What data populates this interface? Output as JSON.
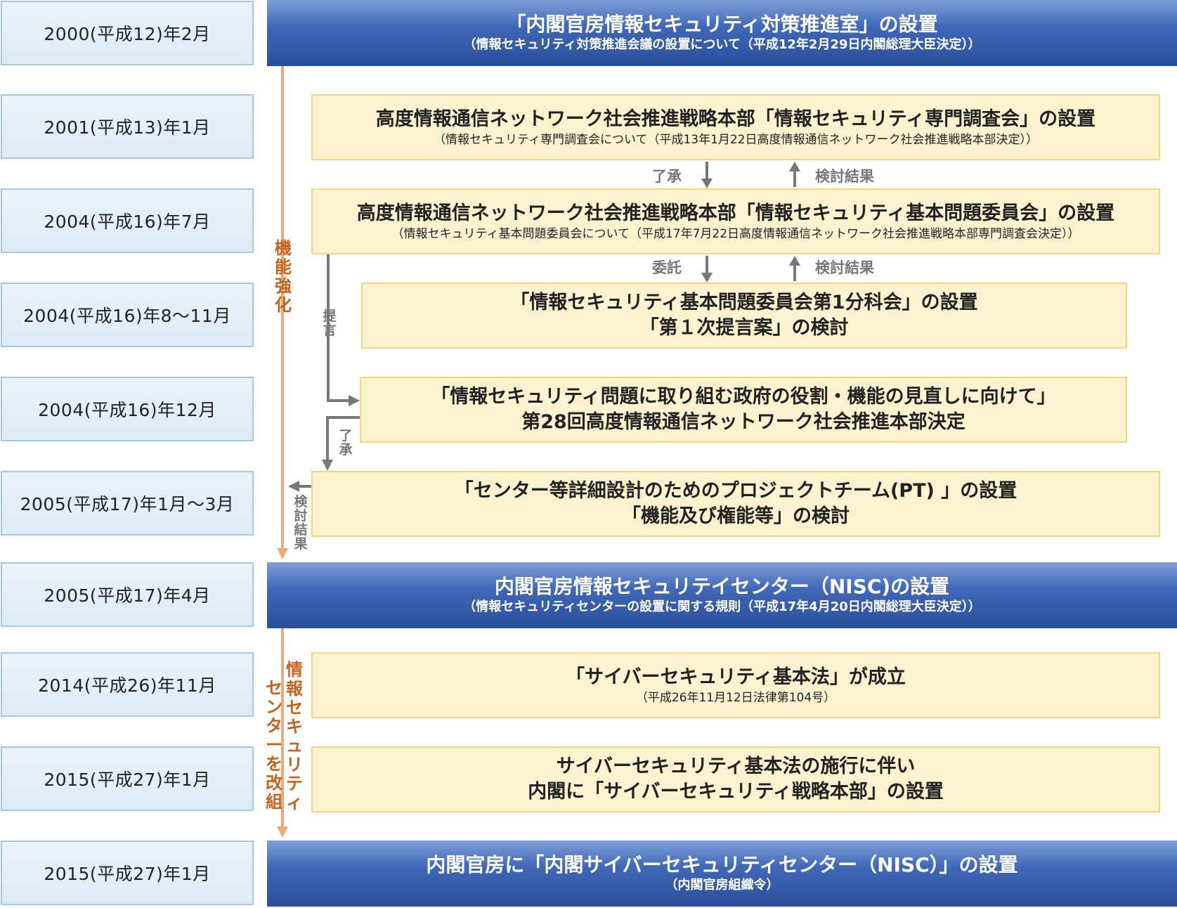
{
  "dates": [
    "2000(平成12)年2月",
    "2001(平成13)年1月",
    "2004(平成16)年7月",
    "2004(平成16)年8～11月",
    "2004(平成16)年12月",
    "2005(平成17)年1月～3月",
    "2005(平成17)年4月",
    "2014(平成26)年11月",
    "2015(平成27)年1月",
    "2015(平成27)年1月"
  ],
  "events": {
    "e2000": {
      "title": "「内閣官房情報セキュリティ対策推進室」の設置",
      "sub": "（情報セキュリティ対策推進会議の設置について（平成12年2月29日内閣総理大臣決定））"
    },
    "e2001": {
      "title": "高度情報通信ネットワーク社会推進戦略本部「情報セキュリティ専門調査会」の設置",
      "sub": "（情報セキュリティ専門調査会について（平成13年1月22日高度情報通信ネットワーク社会推進戦略本部決定））"
    },
    "e2004_7": {
      "title": "高度情報通信ネットワーク社会推進戦略本部「情報セキュリティ基本問題委員会」の設置",
      "sub": "（情報セキュリティ基本問題委員会について（平成17年7月22日高度情報通信ネットワーク社会推進戦略本部専門調査会決定））"
    },
    "e2004_8": {
      "line1": "「情報セキュリティ基本問題委員会第1分科会」の設置",
      "line2": "「第１次提言案」の検討"
    },
    "e2004_12": {
      "line1": "「情報セキュリティ問題に取り組む政府の役割・機能の見直しに向けて」",
      "line2": "第28回高度情報通信ネットワーク社会推進本部決定"
    },
    "e2005_1": {
      "line1": "「センター等詳細設計のためのプロジェクトチーム(PT) 」の設置",
      "line2": "「機能及び権能等」の検討"
    },
    "e2005_4": {
      "title": "内閣官房情報セキュリテイセンター（NISC)の設置",
      "sub": "（情報セキュリティセンターの設置に関する規則（平成17年4月20日内閣総理大臣決定））"
    },
    "e2014": {
      "title": "「サイバーセキュリティ基本法」が成立",
      "sub": "（平成26年11月12日法律第104号）"
    },
    "e2015a": {
      "line1": "サイバーセキュリティ基本法の施行に伴い",
      "line2": "内閣に「サイバーセキュリティ戦略本部」の設置"
    },
    "e2015b": {
      "title": "内閣官房に「内閣サイバーセキュリティセンター（NISC）」の設置",
      "sub": "（内閣官房組織令）"
    }
  },
  "arrow_labels": {
    "ryosho1": "了承",
    "kento1": "検討結果",
    "itaku": "委託",
    "kento2": "検討結果",
    "teigen": "提言",
    "ryosho2": "了承",
    "kento3": "検討結果"
  },
  "timeline_labels": {
    "kinou": "機能強化",
    "kaiso_col1": "情報セキュリティ",
    "kaiso_col2": "センターを改組"
  },
  "colors": {
    "blue": "#2a4f9a",
    "yellow_fill": "#fbf3cf",
    "yellow_border": "#f2d77d",
    "date_border": "#a7c8e2",
    "timeline_orange": "#efa878",
    "label_orange": "#c7621d",
    "arrow_gray": "#777777"
  }
}
